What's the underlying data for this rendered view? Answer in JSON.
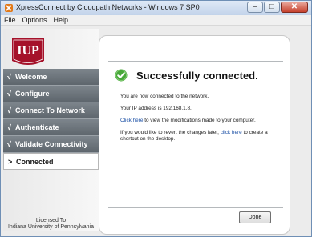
{
  "window": {
    "title": "XpressConnect by Cloudpath Networks - Windows 7 SP0",
    "controls": {
      "minimize": "–",
      "maximize": "□",
      "close": "✕"
    }
  },
  "menu": [
    "File",
    "Options",
    "Help"
  ],
  "logo": {
    "text": "IUP",
    "color": "#a5122a"
  },
  "nav": [
    {
      "mark": "√",
      "label": "Welcome",
      "state": "done"
    },
    {
      "mark": "√",
      "label": "Configure",
      "state": "done"
    },
    {
      "mark": "√",
      "label": "Connect To Network",
      "state": "done"
    },
    {
      "mark": "√",
      "label": "Authenticate",
      "state": "done"
    },
    {
      "mark": "√",
      "label": "Validate Connectivity",
      "state": "done"
    },
    {
      "mark": ">",
      "label": "Connected",
      "state": "active"
    }
  ],
  "license": {
    "line1": "Licensed To",
    "line2": "Indiana University of Pennsylvania"
  },
  "content": {
    "heading": "Successfully connected.",
    "line1": "You are now connected to the network.",
    "line2": "Your IP address is 192.168.1.8.",
    "line3_link": "Click here",
    "line3_rest": " to view the modifications made to your computer.",
    "line4_pre": "If you would like to revert the changes later, ",
    "line4_link": "click here",
    "line4_post": " to create a shortcut on the desktop."
  },
  "done_button": "Done",
  "colors": {
    "success": "#48a83a",
    "nav_bg": "#6a7279",
    "link": "#1a4fa5"
  }
}
